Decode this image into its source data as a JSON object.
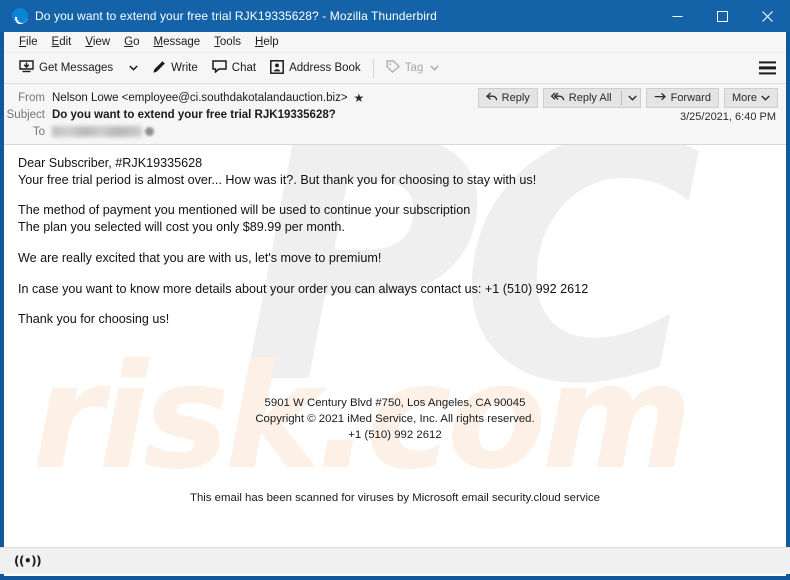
{
  "window": {
    "title": "Do you want to extend your free trial RJK19335628? - Mozilla Thunderbird",
    "app_icon": "thunderbird-icon",
    "controls": {
      "minimize": "minimize-icon",
      "maximize": "maximize-icon",
      "close": "close-icon"
    },
    "titlebar_color": "#1463a8",
    "frame_color": "#12599c"
  },
  "menubar": {
    "items": [
      {
        "label": "File",
        "mnemonic": "F"
      },
      {
        "label": "Edit",
        "mnemonic": "E"
      },
      {
        "label": "View",
        "mnemonic": "V"
      },
      {
        "label": "Go",
        "mnemonic": "G"
      },
      {
        "label": "Message",
        "mnemonic": "M"
      },
      {
        "label": "Tools",
        "mnemonic": "T"
      },
      {
        "label": "Help",
        "mnemonic": "H"
      }
    ]
  },
  "toolbar": {
    "get_messages": "Get Messages",
    "get_messages_icon": "download-inbox-icon",
    "get_messages_chevron": "chevron-down-icon",
    "write": "Write",
    "write_icon": "pencil-icon",
    "chat": "Chat",
    "chat_icon": "speech-bubble-icon",
    "address_book": "Address Book",
    "address_book_icon": "contact-card-icon",
    "tag": "Tag",
    "tag_icon": "tag-icon",
    "tag_chevron": "chevron-down-icon",
    "tag_disabled": true,
    "app_menu_icon": "hamburger-menu-icon"
  },
  "message_header": {
    "from_label": "From",
    "from_value": "Nelson Lowe <employee@ci.southdakotalandauction.biz>",
    "from_star_icon": "star-icon",
    "subject_label": "Subject",
    "subject_value": "Do you want to extend your free trial RJK19335628?",
    "to_label": "To",
    "to_value": "",
    "to_redacted": true,
    "date": "3/25/2021, 6:40 PM",
    "actions": {
      "reply": "Reply",
      "reply_icon": "reply-arrow-icon",
      "reply_all": "Reply All",
      "reply_all_icon": "reply-all-arrow-icon",
      "reply_all_chevron": "chevron-down-icon",
      "forward": "Forward",
      "forward_icon": "forward-arrow-icon",
      "more": "More",
      "more_chevron": "chevron-down-icon"
    }
  },
  "message_body": {
    "greeting": "Dear Subscriber, #RJK19335628",
    "line_trial": "Your free trial period is almost over... How was it?. But thank you for choosing to stay with us!",
    "line_payment": "The method of payment you mentioned will be used to continue your subscription",
    "line_plan": "The plan you selected will cost you only $89.99 per month.",
    "line_excited": "We are really excited that you are with us, let's move to premium!",
    "line_contact": "In case you want to know more details about your order you can always contact us: +1 (510) 992 2612",
    "line_thanks": "Thank you for choosing us!",
    "footer_address": "5901 W Century Blvd #750, Los Angeles, CA 90045",
    "footer_copyright": "Copyright © 2021 iMed Service, Inc. All rights reserved.",
    "footer_phone": "+1 (510) 992 2612",
    "scanned_notice": "This email has been scanned for viruses by Microsoft email security.cloud service"
  },
  "watermark": {
    "text_primary": "PC",
    "text_secondary": "risk.com",
    "color_primary": "#efefef",
    "color_secondary": "#fdf0e6"
  },
  "statusbar": {
    "connection_icon": "((•))",
    "connection_icon_name": "network-activity-icon"
  }
}
